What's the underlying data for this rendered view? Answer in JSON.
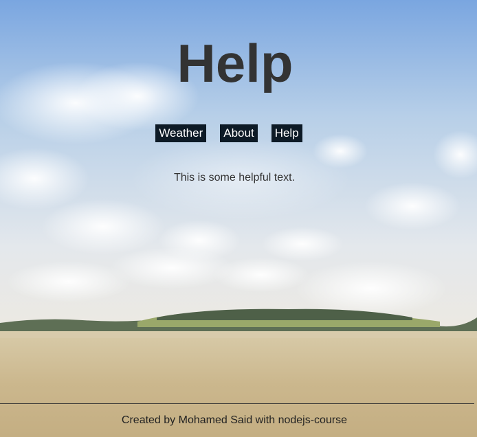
{
  "page": {
    "title": "Help",
    "body_text": "This is some helpful text.",
    "footer": "Created by Mohamed Said with nodejs-course"
  },
  "nav": {
    "items": [
      {
        "label": "Weather"
      },
      {
        "label": "About"
      },
      {
        "label": "Help"
      }
    ]
  },
  "colors": {
    "nav_background": "#0d1a26",
    "nav_text": "#ffffff",
    "text": "#333333",
    "sky_top": "#7aa6e0",
    "field": "#c9b48a"
  }
}
